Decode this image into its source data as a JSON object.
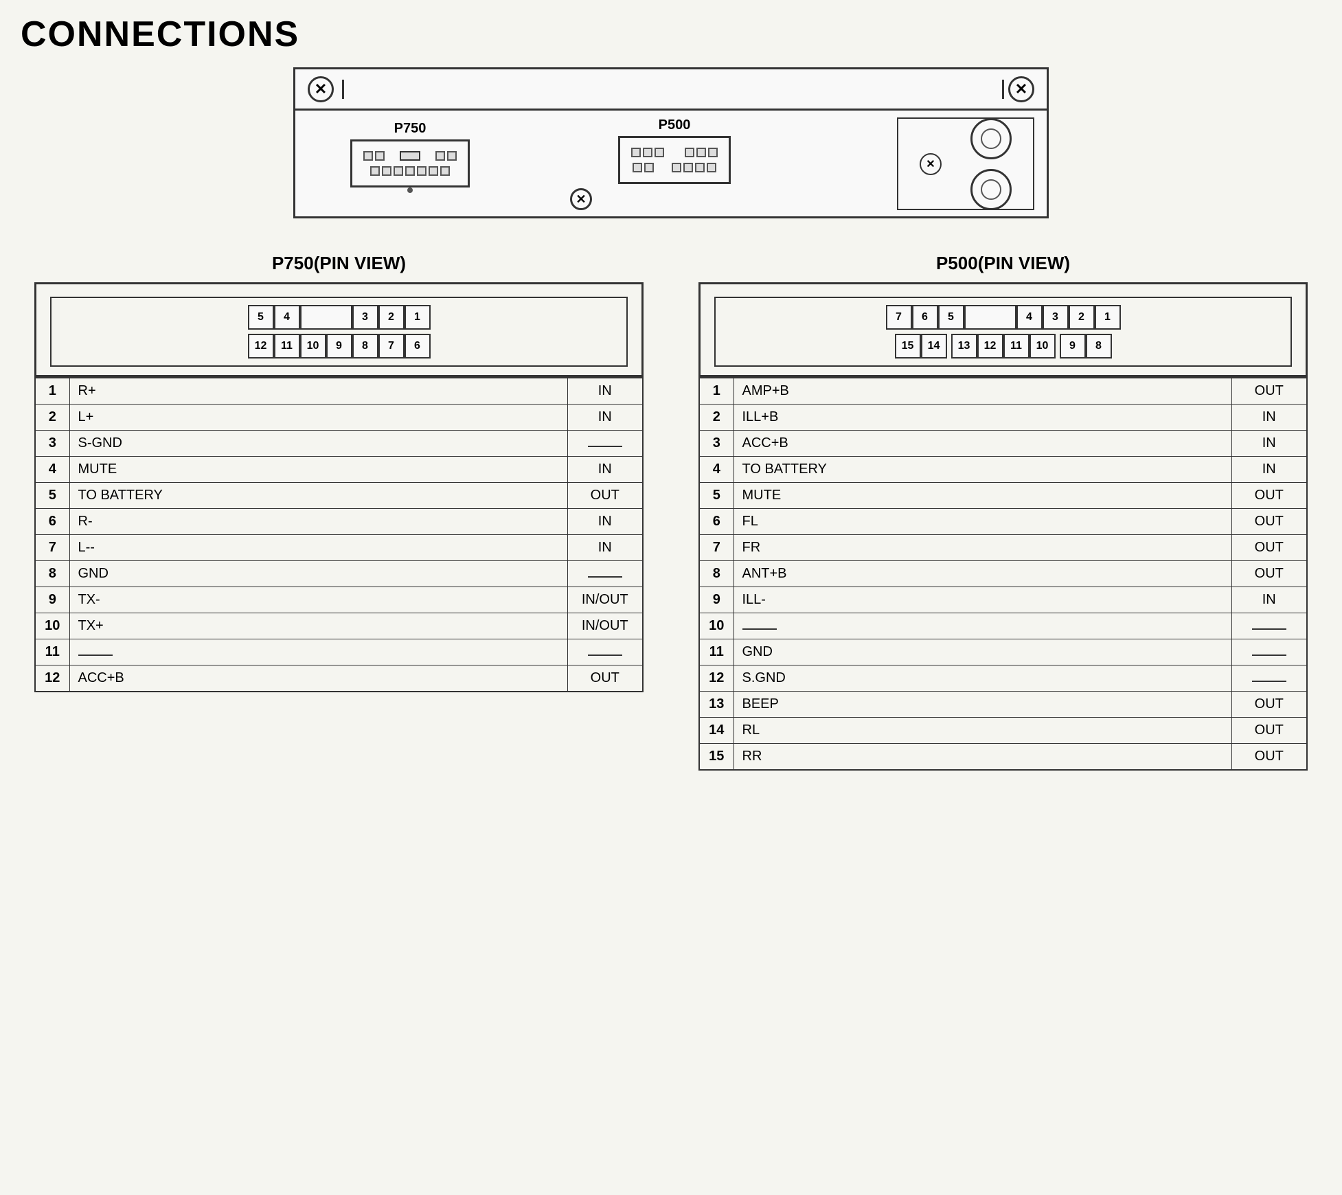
{
  "title": "CONNECTIONS",
  "device": {
    "p750_label": "P750",
    "p500_label": "P500"
  },
  "p750_view": {
    "title": "P750(PIN VIEW)",
    "top_row": [
      "5",
      "4",
      "",
      "3",
      "2",
      "1"
    ],
    "bottom_row": [
      "12",
      "11",
      "10",
      "9",
      "8",
      "7",
      "6"
    ],
    "pins": [
      {
        "num": "1",
        "signal": "R+",
        "dir": "IN"
      },
      {
        "num": "2",
        "signal": "L+",
        "dir": "IN"
      },
      {
        "num": "3",
        "signal": "S-GND",
        "dir": "—"
      },
      {
        "num": "4",
        "signal": "MUTE",
        "dir": "IN"
      },
      {
        "num": "5",
        "signal": "TO BATTERY",
        "dir": "OUT"
      },
      {
        "num": "6",
        "signal": "R-",
        "dir": "IN"
      },
      {
        "num": "7",
        "signal": "L--",
        "dir": "IN"
      },
      {
        "num": "8",
        "signal": "GND",
        "dir": "—"
      },
      {
        "num": "9",
        "signal": "TX-",
        "dir": "IN/OUT"
      },
      {
        "num": "10",
        "signal": "TX+",
        "dir": "IN/OUT"
      },
      {
        "num": "11",
        "signal": "—",
        "dir": "—"
      },
      {
        "num": "12",
        "signal": "ACC+B",
        "dir": "OUT"
      }
    ]
  },
  "p500_view": {
    "title": "P500(PIN VIEW)",
    "top_row": [
      "7",
      "6",
      "5",
      "",
      "4",
      "3",
      "2",
      "1"
    ],
    "bottom_row": [
      "15",
      "14",
      "",
      "13",
      "12",
      "11",
      "10",
      "",
      "9",
      "8"
    ],
    "pins": [
      {
        "num": "1",
        "signal": "AMP+B",
        "dir": "OUT"
      },
      {
        "num": "2",
        "signal": "ILL+B",
        "dir": "IN"
      },
      {
        "num": "3",
        "signal": "ACC+B",
        "dir": "IN"
      },
      {
        "num": "4",
        "signal": "TO BATTERY",
        "dir": "IN"
      },
      {
        "num": "5",
        "signal": "MUTE",
        "dir": "OUT"
      },
      {
        "num": "6",
        "signal": "FL",
        "dir": "OUT"
      },
      {
        "num": "7",
        "signal": "FR",
        "dir": "OUT"
      },
      {
        "num": "8",
        "signal": "ANT+B",
        "dir": "OUT"
      },
      {
        "num": "9",
        "signal": "ILL-",
        "dir": "IN"
      },
      {
        "num": "10",
        "signal": "—",
        "dir": "—"
      },
      {
        "num": "11",
        "signal": "GND",
        "dir": "—"
      },
      {
        "num": "12",
        "signal": "S.GND",
        "dir": "—"
      },
      {
        "num": "13",
        "signal": "BEEP",
        "dir": "OUT"
      },
      {
        "num": "14",
        "signal": "RL",
        "dir": "OUT"
      },
      {
        "num": "15",
        "signal": "RR",
        "dir": "OUT"
      }
    ]
  }
}
